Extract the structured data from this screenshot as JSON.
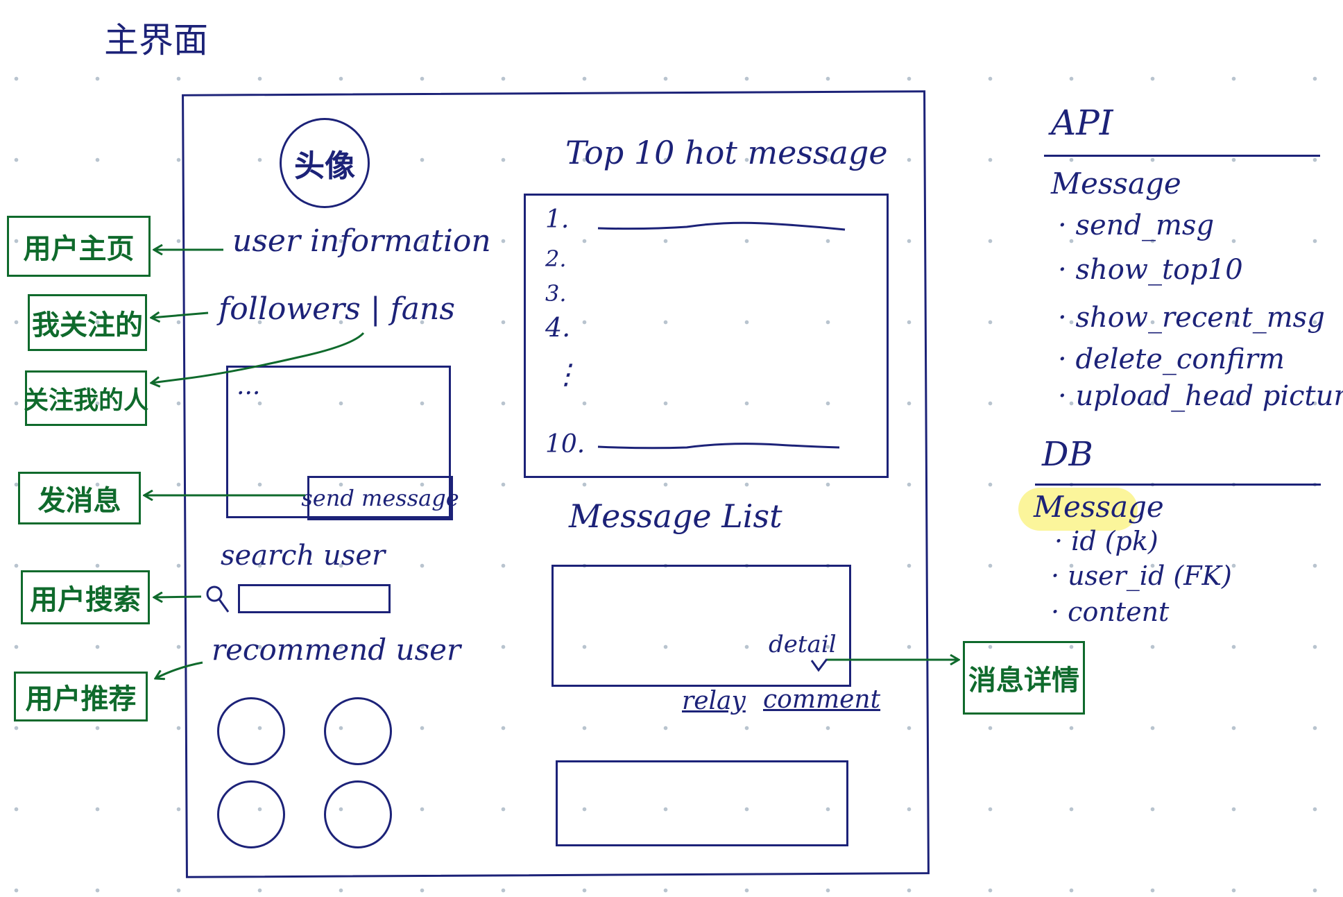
{
  "page_title": "主界面",
  "avatar_label": "头像",
  "left_labels": {
    "user_information": "user information",
    "followers_fans": "followers | fans",
    "ellipsis": "...",
    "send_message": "send message",
    "search_user": "search user",
    "recommend_user": "recommend user"
  },
  "annotations": {
    "user_home": "用户主页",
    "my_follows": "我关注的",
    "my_followers": "关注我的人",
    "send_msg": "发消息",
    "user_search": "用户搜索",
    "user_recommend": "用户推荐",
    "message_detail": "消息详情"
  },
  "top10": {
    "title": "Top 10 hot message",
    "numbers": [
      "1.",
      "2.",
      "3.",
      "4.",
      "⋮",
      "10."
    ]
  },
  "message_list": {
    "title": "Message List",
    "detail": "detail",
    "relay": "relay",
    "comment": "comment"
  },
  "api": {
    "heading": "API",
    "group": "Message",
    "items": [
      "send_msg",
      "show_top10",
      "show_recent_msg",
      "delete_confirm",
      "upload_head picture"
    ]
  },
  "db": {
    "heading": "DB",
    "table": "Message",
    "fields": [
      "id (pk)",
      "user_id (FK)",
      "content"
    ]
  },
  "colors": {
    "navy": "#1c2278",
    "green": "#0f6a2c",
    "highlight": "#fbf59b",
    "grid_dot": "#b9c4cf"
  }
}
